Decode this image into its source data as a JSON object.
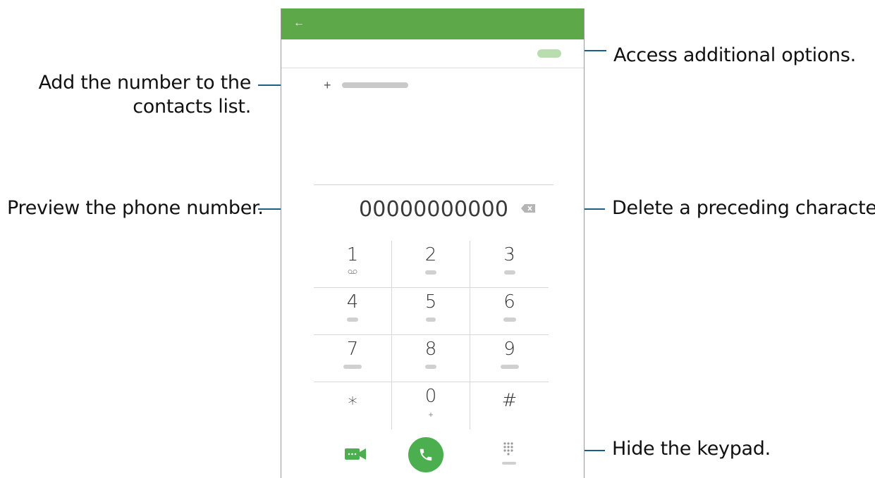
{
  "callouts": {
    "more_options": "Access additional options.",
    "add_contact_line1": "Add the number to the",
    "add_contact_line2": "contacts list.",
    "preview_number": "Preview the phone number.",
    "delete_char": "Delete a preceding character.",
    "hide_keypad": "Hide the keypad."
  },
  "phone": {
    "accent_color": "#5da94a",
    "back_icon": "back-arrow-icon",
    "number": "00000000000",
    "backspace_icon": "backspace-icon",
    "add_icon": "plus-icon",
    "keys": [
      {
        "digit": "1",
        "sub": "voicemail-icon"
      },
      {
        "digit": "2",
        "sub": ""
      },
      {
        "digit": "3",
        "sub": ""
      },
      {
        "digit": "4",
        "sub": ""
      },
      {
        "digit": "5",
        "sub": ""
      },
      {
        "digit": "6",
        "sub": ""
      },
      {
        "digit": "7",
        "sub": ""
      },
      {
        "digit": "8",
        "sub": ""
      },
      {
        "digit": "9",
        "sub": ""
      },
      {
        "digit": "∗",
        "sub": ""
      },
      {
        "digit": "0",
        "sub": "+"
      },
      {
        "digit": "#",
        "sub": ""
      }
    ],
    "video_call_icon": "video-call-icon",
    "call_icon": "phone-call-icon",
    "hide_keypad_icon": "keypad-icon"
  }
}
